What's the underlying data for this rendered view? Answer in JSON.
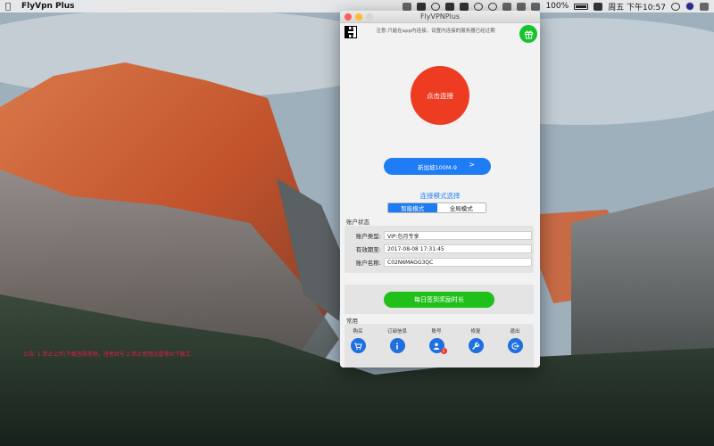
{
  "menubar": {
    "app_name": "FlyVpn Plus",
    "battery": "100%",
    "clock": "周五 下午10:57"
  },
  "window": {
    "title": "FlyVPNPlus",
    "notice_top": "注意:只能在app内连接，设置内连接的服务器已经过期",
    "connect_label": "点击连接",
    "line_label": "新加坡100M-9",
    "line_arrow": ">",
    "mode_title": "连接模式选择",
    "modes": [
      "智能模式",
      "全局模式"
    ],
    "active_mode": "智能模式",
    "account_section": "账户状态",
    "account": {
      "type_label": "账户类型:",
      "type_value": "VIP:包月专享",
      "expiry_label": "有效期至:",
      "expiry_value": "2017-08-08 17:31:45",
      "name_label": "账户名称:",
      "name_value": "C02N6MAGG3QC"
    },
    "signin_label": "每日签到奖励时长",
    "common_section": "常用",
    "tools": [
      {
        "label": "购买",
        "icon": "cart-icon"
      },
      {
        "label": "订阅信息",
        "icon": "info-icon"
      },
      {
        "label": "账号",
        "icon": "user-icon",
        "badge": "1"
      },
      {
        "label": "修复",
        "icon": "wrench-icon"
      },
      {
        "label": "退出",
        "icon": "logout-icon"
      }
    ],
    "ticker": "公告: 1.禁止上传/下载违规视频。违者封号 2.禁止使用迅雷等bt下载工"
  },
  "colors": {
    "connect": "#ee3c22",
    "primary_blue": "#1e7cf5",
    "green": "#1fc019",
    "ticker_red": "#e0204a"
  }
}
